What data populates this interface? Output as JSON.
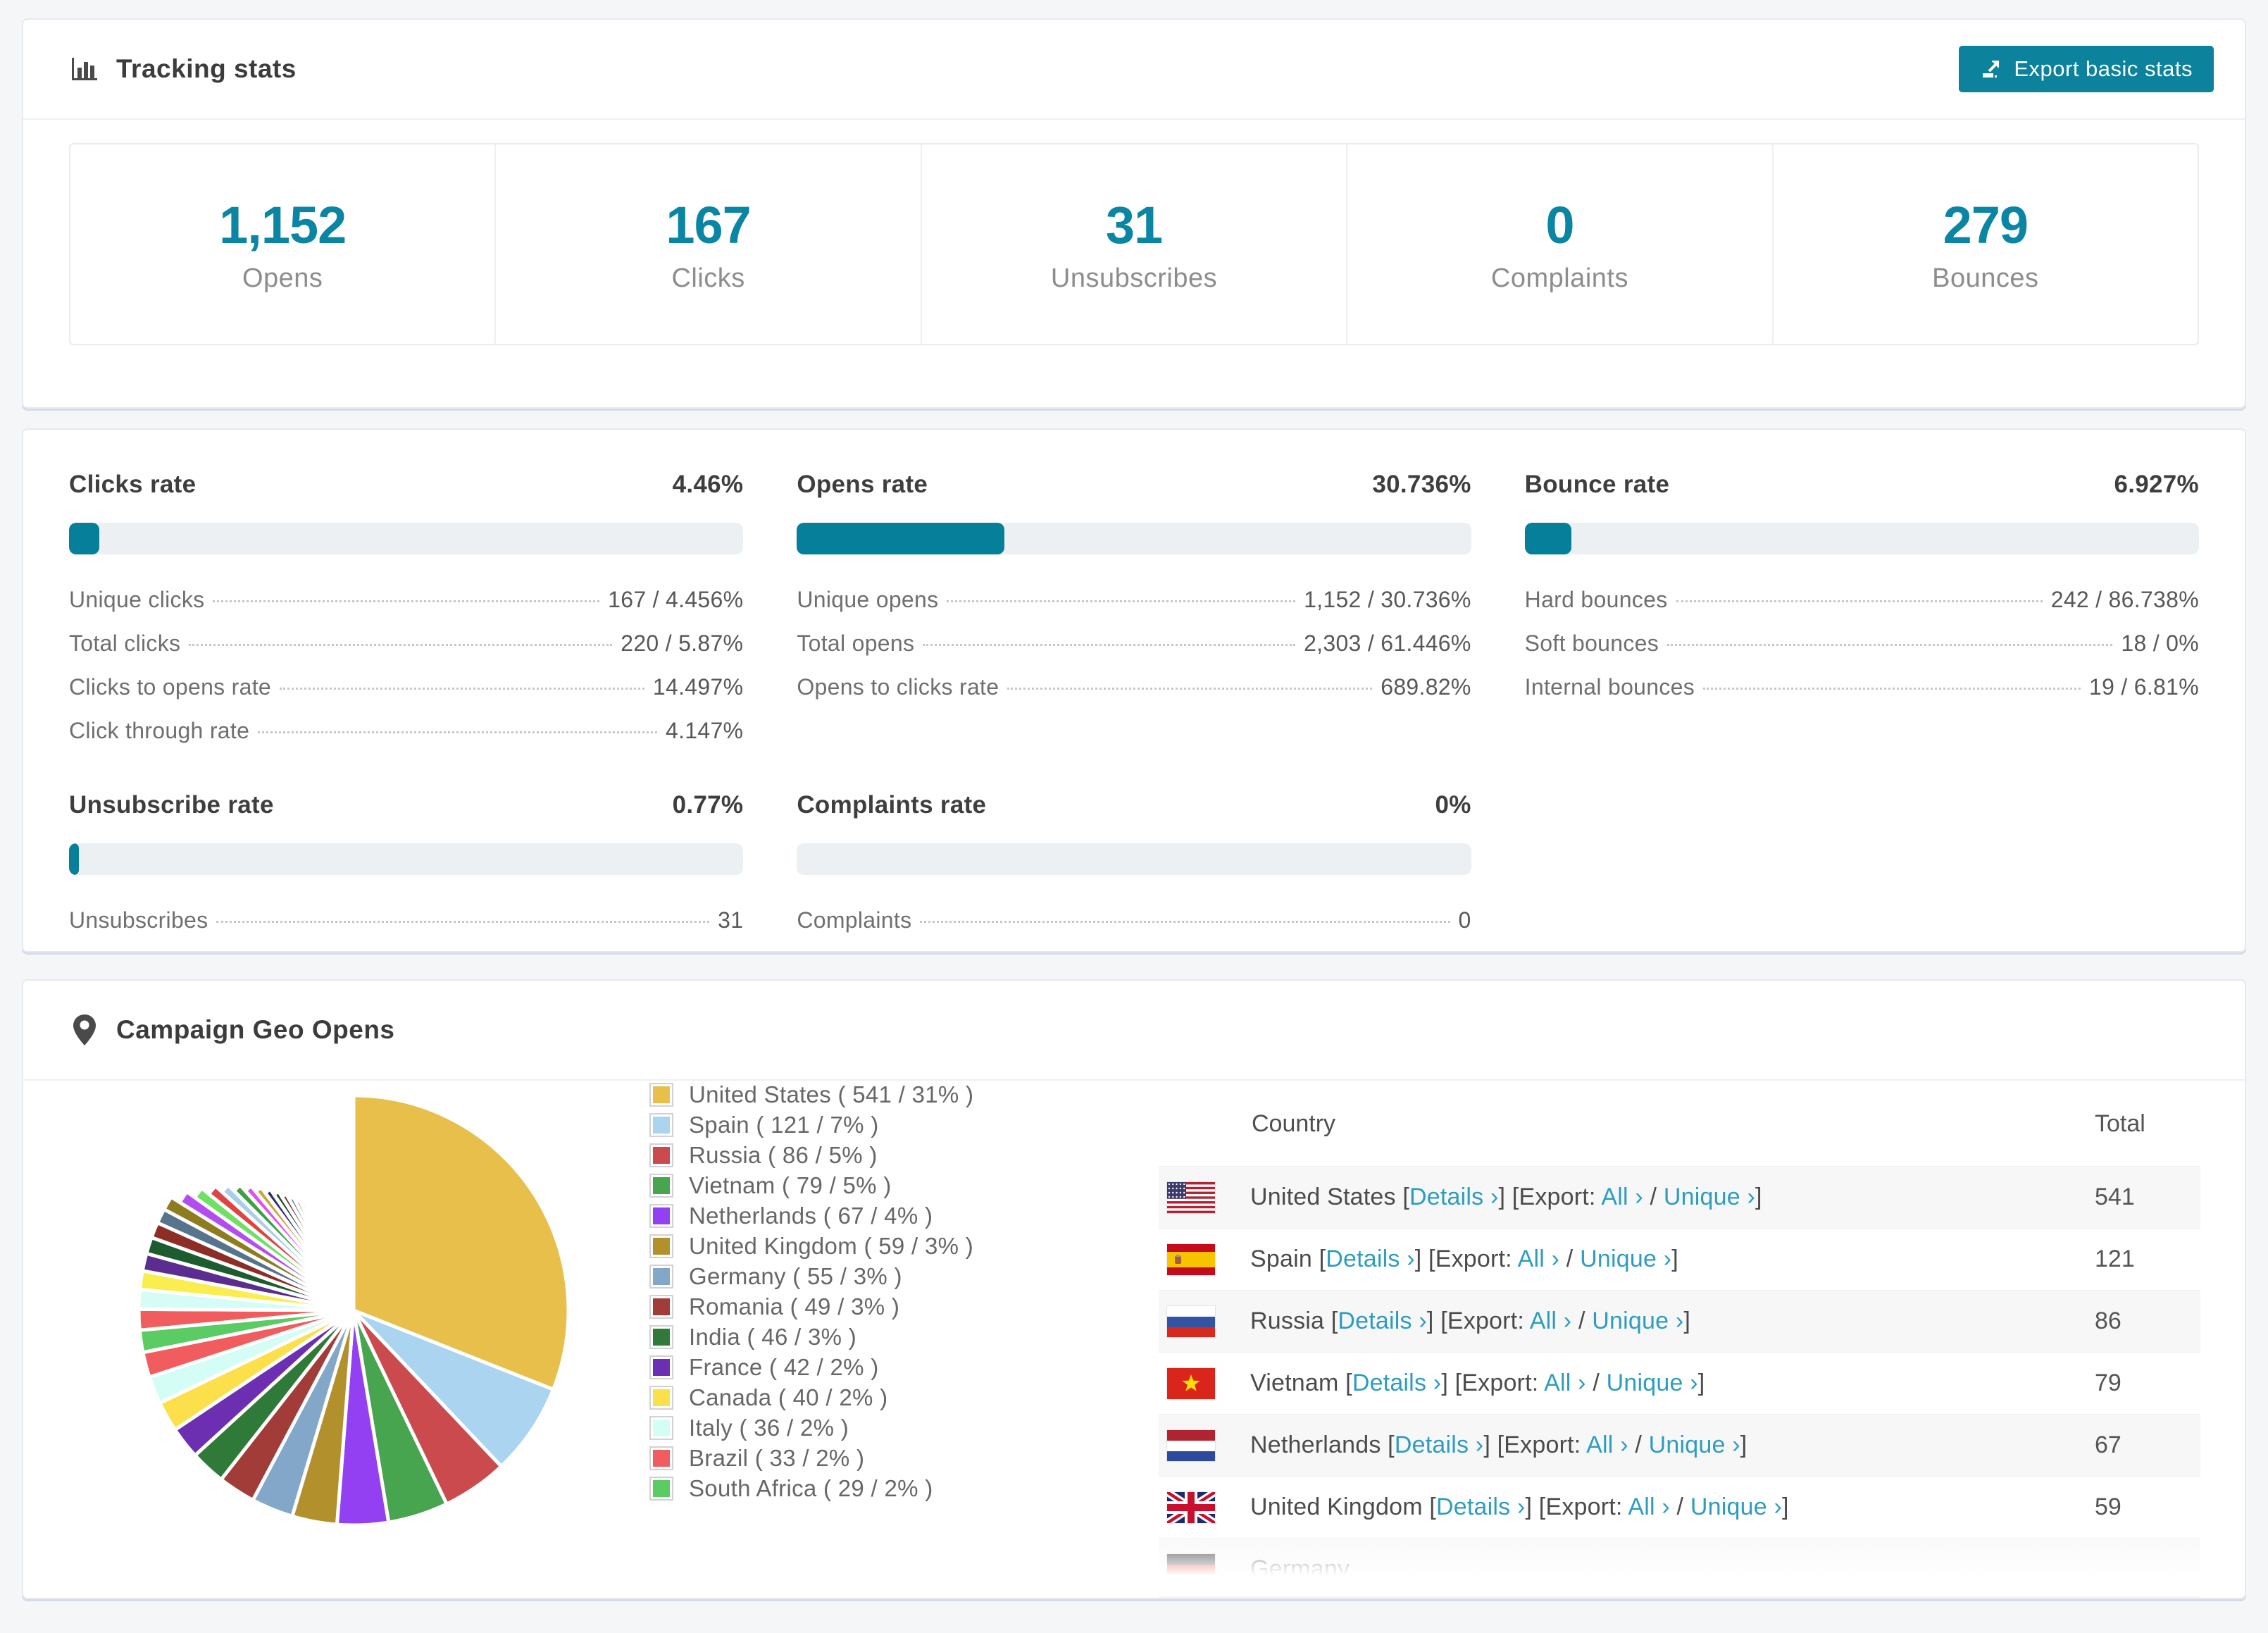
{
  "accent_color": "#067f9a",
  "link_color": "#2d9dbf",
  "tracking": {
    "title": "Tracking stats",
    "export_button_label": "Export basic stats",
    "stats": [
      {
        "value": "1,152",
        "label": "Opens"
      },
      {
        "value": "167",
        "label": "Clicks"
      },
      {
        "value": "31",
        "label": "Unsubscribes"
      },
      {
        "value": "0",
        "label": "Complaints"
      },
      {
        "value": "279",
        "label": "Bounces"
      }
    ]
  },
  "rates": [
    {
      "title": "Clicks rate",
      "value": "4.46%",
      "percent": 4.46,
      "rows": [
        [
          "Unique clicks",
          "167 / 4.456%"
        ],
        [
          "Total clicks",
          "220 / 5.87%"
        ],
        [
          "Clicks to opens rate",
          "14.497%"
        ],
        [
          "Click through rate",
          "4.147%"
        ]
      ]
    },
    {
      "title": "Opens rate",
      "value": "30.736%",
      "percent": 30.736,
      "rows": [
        [
          "Unique opens",
          "1,152 / 30.736%"
        ],
        [
          "Total opens",
          "2,303 / 61.446%"
        ],
        [
          "Opens to clicks rate",
          "689.82%"
        ]
      ]
    },
    {
      "title": "Bounce rate",
      "value": "6.927%",
      "percent": 6.927,
      "rows": [
        [
          "Hard bounces",
          "242 / 86.738%"
        ],
        [
          "Soft bounces",
          "18 / 0%"
        ],
        [
          "Internal bounces",
          "19 / 6.81%"
        ]
      ]
    },
    {
      "title": "Unsubscribe rate",
      "value": "0.77%",
      "percent": 0.77,
      "rows": [
        [
          "Unsubscribes",
          "31"
        ]
      ]
    },
    {
      "title": "Complaints rate",
      "value": "0%",
      "percent": 0,
      "rows": [
        [
          "Complaints",
          "0"
        ]
      ]
    }
  ],
  "geo": {
    "title": "Campaign Geo Opens",
    "links": {
      "details": "Details ›",
      "export": "Export:",
      "all": "All ›",
      "unique": "Unique ›"
    },
    "table": {
      "headers": [
        "Country",
        "Total"
      ],
      "rows": [
        {
          "country": "United States",
          "flag": "us",
          "total": "541"
        },
        {
          "country": "Spain",
          "flag": "es",
          "total": "121"
        },
        {
          "country": "Russia",
          "flag": "ru",
          "total": "86"
        },
        {
          "country": "Vietnam",
          "flag": "vn",
          "total": "79"
        },
        {
          "country": "Netherlands",
          "flag": "nl",
          "total": "67"
        },
        {
          "country": "United Kingdom",
          "flag": "gb",
          "total": "59"
        },
        {
          "country": "Germany",
          "flag": "de",
          "total": "",
          "partial": true
        }
      ]
    }
  },
  "chart_data": {
    "type": "pie",
    "title": "Campaign Geo Opens",
    "legend_position": "right",
    "categories": [
      "United States",
      "Spain",
      "Russia",
      "Vietnam",
      "Netherlands",
      "United Kingdom",
      "Germany",
      "Romania",
      "India",
      "France",
      "Canada",
      "Italy",
      "Brazil",
      "South Africa"
    ],
    "values": [
      541,
      121,
      86,
      79,
      67,
      59,
      55,
      49,
      46,
      42,
      40,
      36,
      33,
      29
    ],
    "display_percents": [
      31,
      7,
      5,
      5,
      4,
      3,
      3,
      3,
      3,
      2,
      2,
      2,
      2,
      2
    ],
    "colors": [
      "#e7bf4a",
      "#abd4f0",
      "#cb4a4d",
      "#47a44f",
      "#9340f2",
      "#b2902c",
      "#82a7c9",
      "#a23c38",
      "#2f7a38",
      "#6c2fb2",
      "#fce04b",
      "#d4fdf6",
      "#f15d5e",
      "#5bcb63"
    ],
    "others": {
      "approx_total": 462,
      "approx_slice_count": 48
    },
    "tail_palette": [
      "#f15d5e",
      "#d4fdf6",
      "#f9ed4f",
      "#5b2d91",
      "#1d5c2f",
      "#8c2d26",
      "#56748c",
      "#8f7c1f",
      "#b44df0",
      "#6ee063",
      "#e04343",
      "#a9cdea",
      "#3f9f46",
      "#e44df0",
      "#c9a63c",
      "#2e2a72",
      "#174a2a",
      "#7a2a24",
      "#4a6b80",
      "#8a7a1e"
    ]
  }
}
